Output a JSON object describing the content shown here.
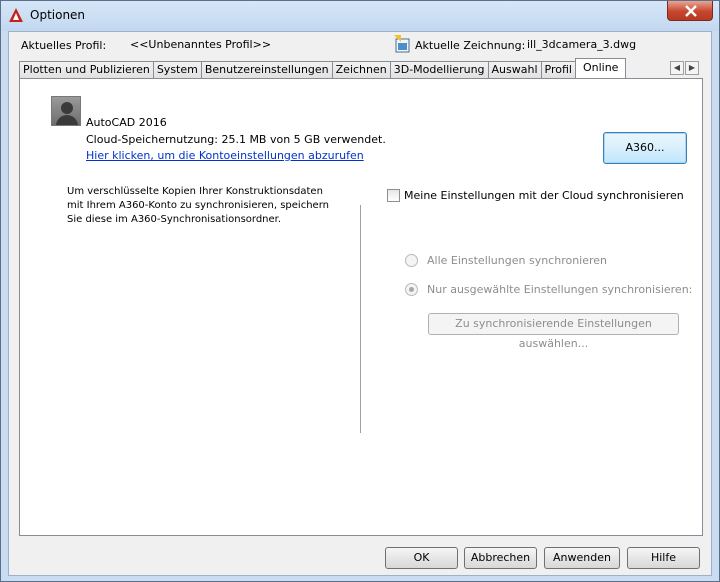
{
  "window": {
    "title": "Optionen",
    "close_icon": "close-icon"
  },
  "header": {
    "profile_label": "Aktuelles Profil:",
    "profile_value": "<<Unbenanntes Profil>>",
    "drawing_label": "Aktuelle Zeichnung:",
    "drawing_value": "ill_3dcamera_3.dwg"
  },
  "tabs": [
    {
      "label": "Plotten und Publizieren"
    },
    {
      "label": "System"
    },
    {
      "label": "Benutzereinstellungen"
    },
    {
      "label": "Zeichnen"
    },
    {
      "label": "3D-Modellierung"
    },
    {
      "label": "Auswahl"
    },
    {
      "label": "Profil"
    },
    {
      "label": "Online",
      "active": true
    }
  ],
  "online": {
    "product": "AutoCAD 2016",
    "usage": "Cloud-Speichernutzung: 25.1 MB von 5 GB verwendet.",
    "account_link": "Hier klicken, um die Kontoeinstellungen abzurufen",
    "a360_button": "A360...",
    "description": "Um verschlüsselte Kopien Ihrer Konstruktionsdaten mit Ihrem A360-Konto zu synchronisieren, speichern Sie diese im A360-Synchronisationsordner.",
    "sync_checkbox": "Meine Einstellungen mit der Cloud synchronisieren",
    "sync_checked": false,
    "radio_all": "Alle Einstellungen synchronieren",
    "radio_selected": "Nur ausgewählte Einstellungen synchronisieren:",
    "selected_option": "radio_selected",
    "choose_button": "Zu synchronisierende Einstellungen auswählen..."
  },
  "footer": {
    "ok": "OK",
    "cancel": "Abbrechen",
    "apply": "Anwenden",
    "help": "Hilfe"
  },
  "colors": {
    "accent_link": "#0033cc",
    "window_frame": "#c9dcf1",
    "close_button": "#c7462e"
  }
}
